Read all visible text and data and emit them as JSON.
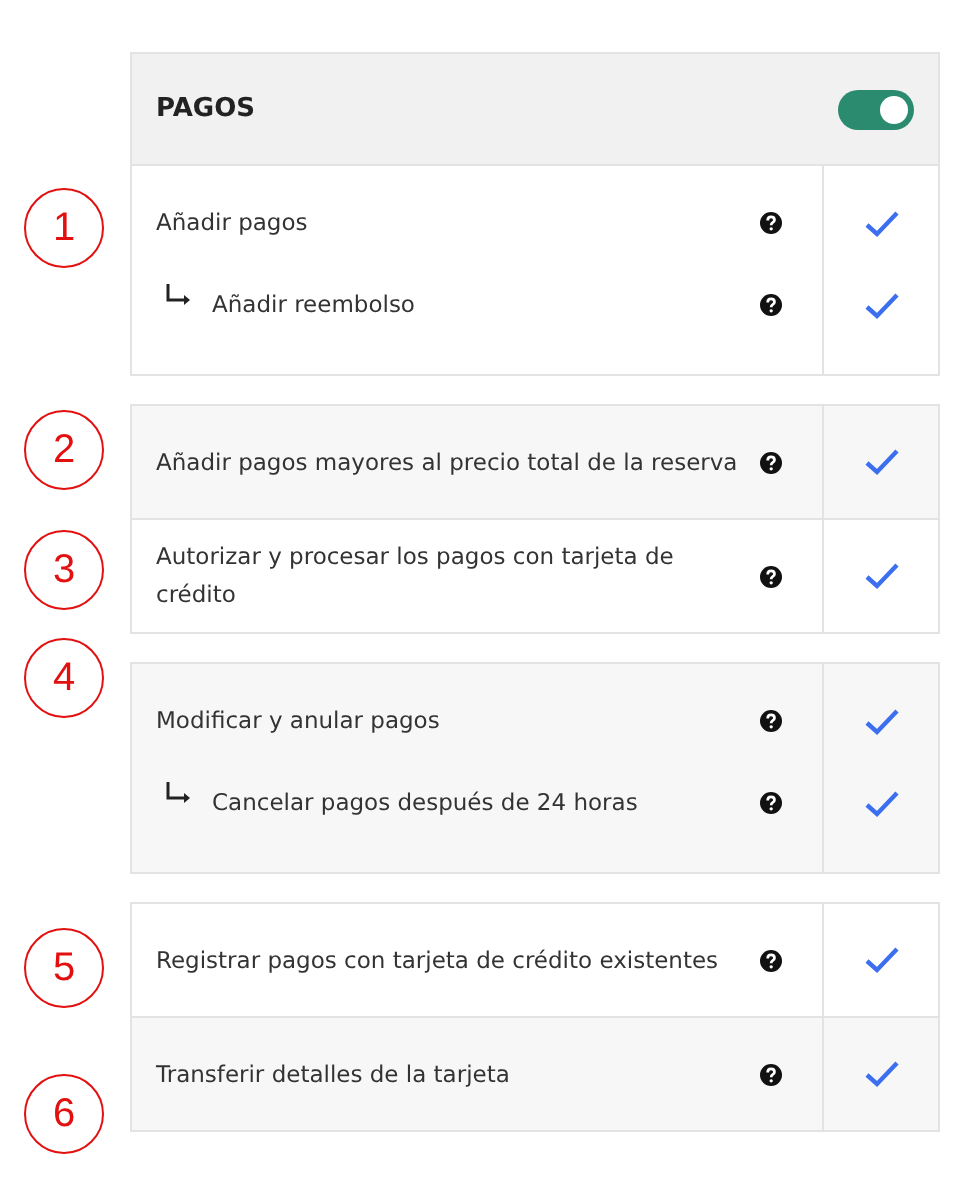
{
  "header": {
    "title": "PAGOS",
    "toggle_on": true
  },
  "groups": [
    [
      {
        "label": "Añadir pagos",
        "checked": true,
        "children": [
          {
            "label": "Añadir reembolso",
            "checked": true
          }
        ]
      }
    ],
    [
      {
        "label": "Añadir pagos mayores al precio total de la reserva",
        "checked": true
      },
      {
        "label": "Autorizar y procesar los pagos con tarjeta de crédito",
        "checked": true
      }
    ],
    [
      {
        "label": "Modificar y anular pagos",
        "checked": true,
        "children": [
          {
            "label": "Cancelar pagos después de 24 horas",
            "checked": true
          }
        ]
      }
    ],
    [
      {
        "label": "Registrar pagos con tarjeta de crédito existentes",
        "checked": true
      },
      {
        "label": "Transferir detalles de la tarjeta",
        "checked": true
      }
    ]
  ],
  "callouts": [
    "1",
    "2",
    "3",
    "4",
    "5",
    "6"
  ]
}
